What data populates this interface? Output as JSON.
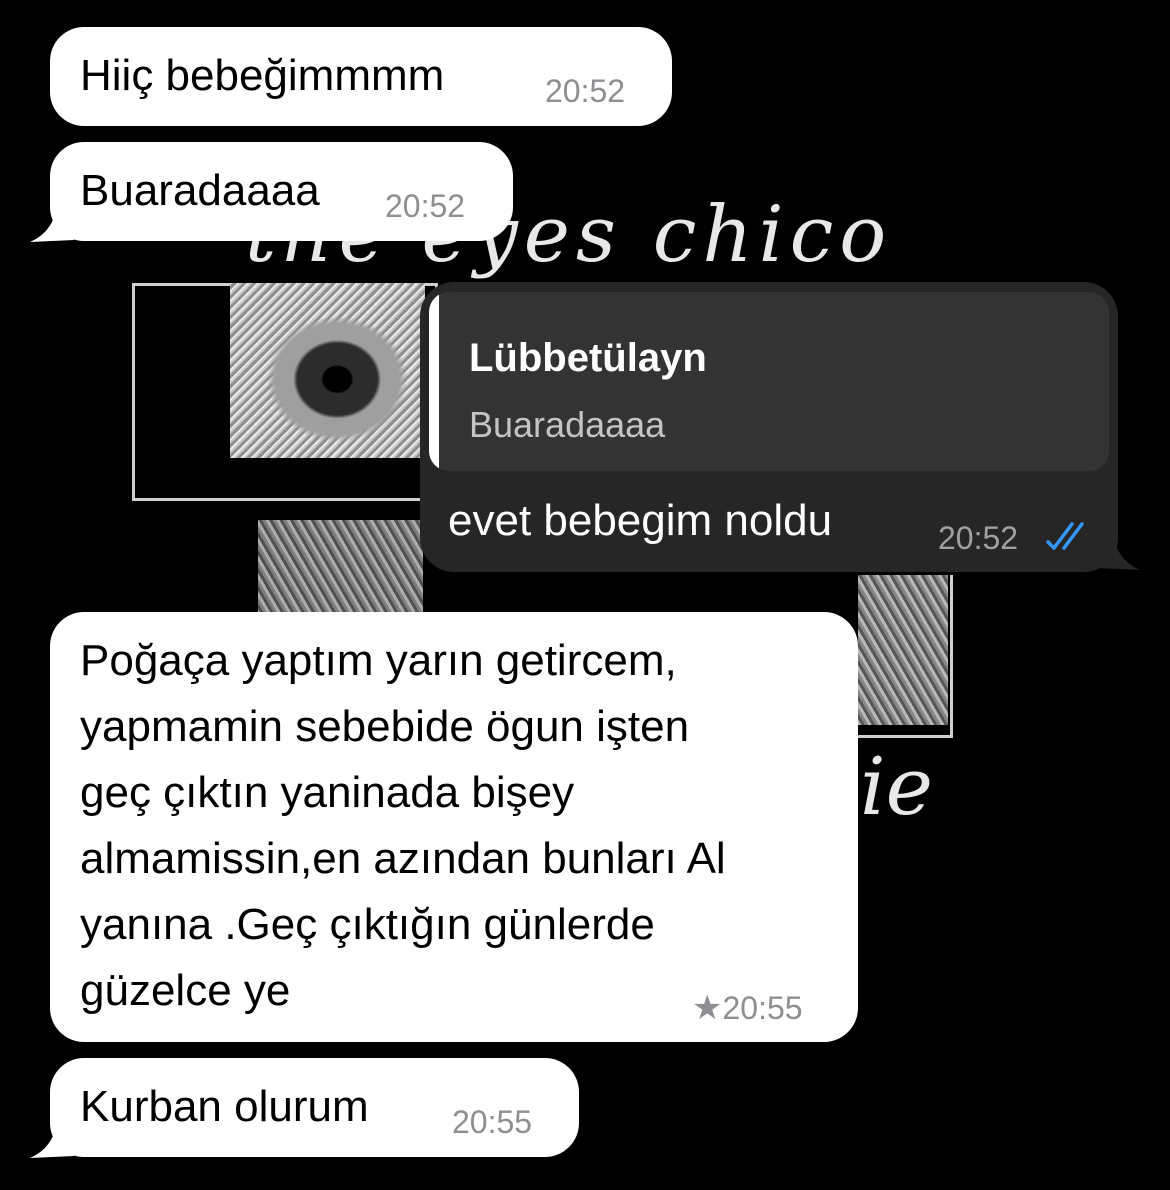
{
  "wallpaper": {
    "script_top": "the eyes chico",
    "script_bottom": "ie"
  },
  "messages": [
    {
      "id": "m1",
      "direction": "incoming",
      "text": "Hiiç bebeğimmmm",
      "time": "20:52"
    },
    {
      "id": "m2",
      "direction": "incoming",
      "text": "Buaradaaaa",
      "time": "20:52"
    },
    {
      "id": "m3",
      "direction": "outgoing",
      "reply": {
        "author": "Lübbetülayn",
        "text": "Buaradaaaa"
      },
      "text": "evet bebegim noldu",
      "time": "20:52",
      "status": "read",
      "status_icon": "double-check-icon",
      "status_color": "#3497f9"
    },
    {
      "id": "m4",
      "direction": "incoming",
      "text": "Poğaça yaptım yarın getircem,\nyapmamin sebebide ögun işten\ngeç çıktın yaninada bişey\nalmamissin,en azından bunları Al\nyanına .Geç çıktığın günlerde\ngüzelce ye",
      "time": "20:55",
      "starred": true,
      "star_glyph": "★"
    },
    {
      "id": "m5",
      "direction": "incoming",
      "text": "Kurban olurum",
      "time": "20:55"
    }
  ],
  "colors": {
    "background": "#000000",
    "incoming_bubble": "#ffffff",
    "outgoing_bubble": "#262626",
    "read_ticks": "#3497f9"
  }
}
